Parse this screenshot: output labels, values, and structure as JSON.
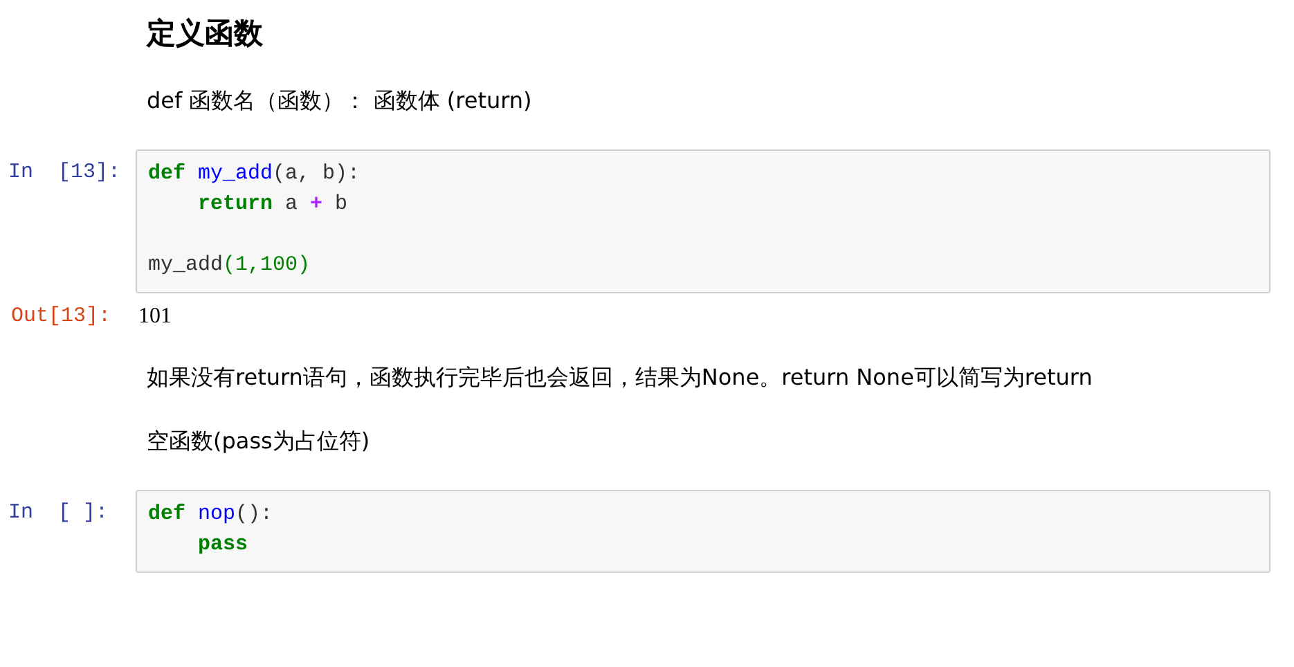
{
  "cells": [
    {
      "kind": "heading",
      "text": "定义函数"
    },
    {
      "kind": "paragraph",
      "text": "def 函数名（函数）： 函数体 (return)"
    },
    {
      "kind": "code",
      "prompt": "In  [13]:",
      "lines": [
        {
          "kind": "code",
          "tokens": [
            {
              "kind": "keyword",
              "text": "def"
            },
            {
              "kind": "defname",
              "text": " my_add"
            },
            {
              "kind": "plain",
              "text": "(a, b):"
            }
          ]
        },
        {
          "kind": "code",
          "tokens": [
            {
              "kind": "keyword",
              "text": "    return"
            },
            {
              "kind": "plain",
              "text": " a "
            },
            {
              "kind": "operator",
              "text": "+"
            },
            {
              "kind": "plain",
              "text": " b"
            }
          ]
        },
        {
          "kind": "blank"
        },
        {
          "kind": "code",
          "tokens": [
            {
              "kind": "plain",
              "text": "my_add"
            },
            {
              "kind": "number",
              "text": "(1,100)"
            }
          ]
        }
      ]
    },
    {
      "kind": "output",
      "prompt": "Out[13]:",
      "text": "101"
    },
    {
      "kind": "paragraph",
      "text": "如果没有return语句，函数执行完毕后也会返回，结果为None。return None可以简写为return"
    },
    {
      "kind": "paragraph",
      "text": "空函数(pass为占位符)"
    },
    {
      "kind": "code",
      "prompt": "In  [ ]:",
      "lines": [
        {
          "kind": "code",
          "tokens": [
            {
              "kind": "keyword",
              "text": "def"
            },
            {
              "kind": "defname",
              "text": " nop"
            },
            {
              "kind": "plain",
              "text": "():"
            }
          ]
        },
        {
          "kind": "code",
          "tokens": [
            {
              "kind": "keyword",
              "text": "    pass"
            }
          ]
        }
      ]
    }
  ]
}
